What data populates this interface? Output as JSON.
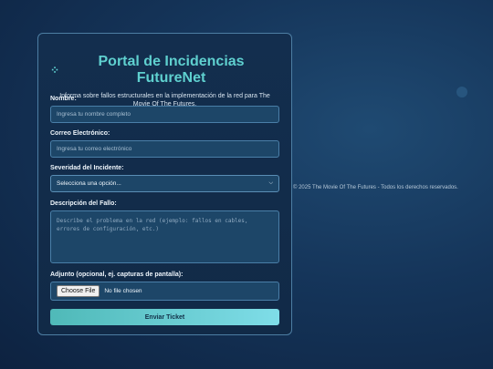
{
  "header": {
    "title": "Portal de Incidencias FutureNet",
    "icon": "sparkle-icon",
    "subtitle": "Informa sobre fallos estructurales en la implementación de la red para The Movie Of The Futures."
  },
  "form": {
    "name": {
      "label": "Nombre:",
      "placeholder": "Ingresa tu nombre completo",
      "value": ""
    },
    "email": {
      "label": "Correo Electrónico:",
      "placeholder": "Ingresa tu correo electrónico",
      "value": ""
    },
    "severity": {
      "label": "Severidad del Incidente:",
      "selected": "Selecciona una opción..."
    },
    "description": {
      "label": "Descripción del Fallo:",
      "placeholder": "Describe el problema en la red (ejemplo: fallos en cables, errores de configuración, etc.)"
    },
    "attachment": {
      "label": "Adjunto (opcional, ej. capturas de pantalla):",
      "button": "Choose File",
      "status": "No file chosen"
    },
    "submit": "Enviar Ticket"
  },
  "footer": {
    "text": "© 2025 The Movie Of The Futures - Todos los derechos reservados."
  },
  "colors": {
    "accent": "#5fd0cf",
    "card_border": "#4d7ea3",
    "background": "#15355a"
  }
}
